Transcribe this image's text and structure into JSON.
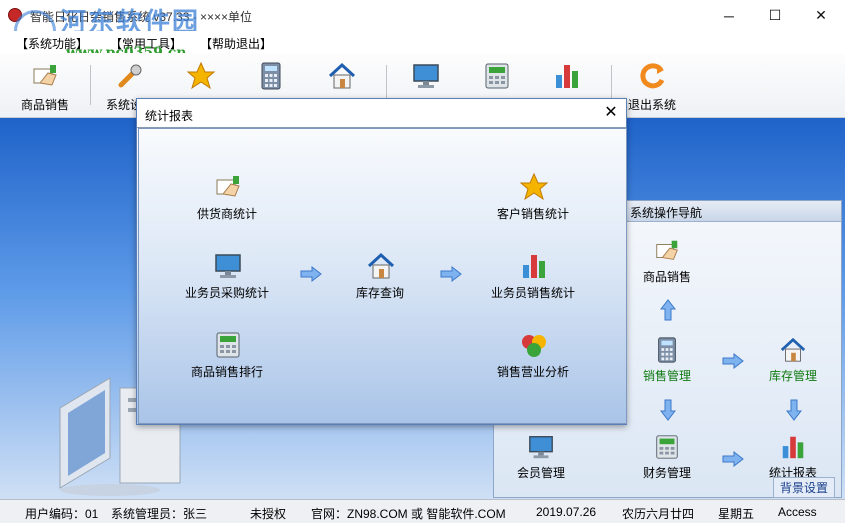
{
  "window": {
    "title": "智能日化日杂销售系统 v37.33 - ××××单位",
    "watermark_text": "河东软件园",
    "watermark_url": "www.pc0359.cn",
    "minimize_glyph": "─",
    "maximize_glyph": "☐",
    "close_glyph": "✕"
  },
  "menu": [
    "【系统功能】",
    "【常用工具】",
    "【帮助退出】"
  ],
  "toolbar": {
    "items": [
      {
        "label": "商品销售",
        "icon": "hand-paper-icon"
      },
      {
        "label": "系统设置",
        "icon": "wrench-icon"
      },
      {
        "label": "",
        "icon": "star-icon"
      },
      {
        "label": "",
        "icon": "calculator-icon"
      },
      {
        "label": "",
        "icon": "house-icon"
      },
      {
        "label": "",
        "icon": "monitor-icon"
      },
      {
        "label": "",
        "icon": "cash-register-icon"
      },
      {
        "label": "",
        "icon": "bar-chart-icon"
      },
      {
        "label": "退出系统",
        "icon": "refresh-exit-icon"
      }
    ]
  },
  "nav_panel": {
    "title": "系统操作导航",
    "items": [
      {
        "label": "商品销售",
        "icon": "hand-paper-icon",
        "green": false
      },
      {
        "label": "销售管理",
        "icon": "calculator-icon",
        "green": true
      },
      {
        "label": "库存管理",
        "icon": "house-icon",
        "green": true
      },
      {
        "label": "会员管理",
        "icon": "monitor-icon",
        "green": false
      },
      {
        "label": "财务管理",
        "icon": "cash-register-icon",
        "green": false
      },
      {
        "label": "统计报表",
        "icon": "bar-chart-icon",
        "green": false
      }
    ],
    "bg_settings": "背景设置"
  },
  "dialog": {
    "title": "统计报表",
    "close_glyph": "✕",
    "items": [
      {
        "label": "供货商统计",
        "icon": "hand-paper-icon"
      },
      {
        "label": "客户销售统计",
        "icon": "star-icon"
      },
      {
        "label": "业务员采购统计",
        "icon": "monitor-icon"
      },
      {
        "label": "库存查询",
        "icon": "house-icon"
      },
      {
        "label": "业务员销售统计",
        "icon": "bar-chart-icon"
      },
      {
        "label": "商品销售排行",
        "icon": "cash-register-icon"
      },
      {
        "label": "销售营业分析",
        "icon": "cubes-icon"
      }
    ]
  },
  "status": {
    "user_code": "用户编码：01",
    "manager": "系统管理员：张三",
    "license": "未授权",
    "website": "官网：ZN98.COM 或 智能软件.COM",
    "date": "2019.07.26",
    "lunar": "农历六月廿四",
    "weekday": "星期五",
    "db": "Access"
  },
  "colors": {
    "accent_blue": "#1f63c9",
    "green_label": "#0f7a0f"
  }
}
